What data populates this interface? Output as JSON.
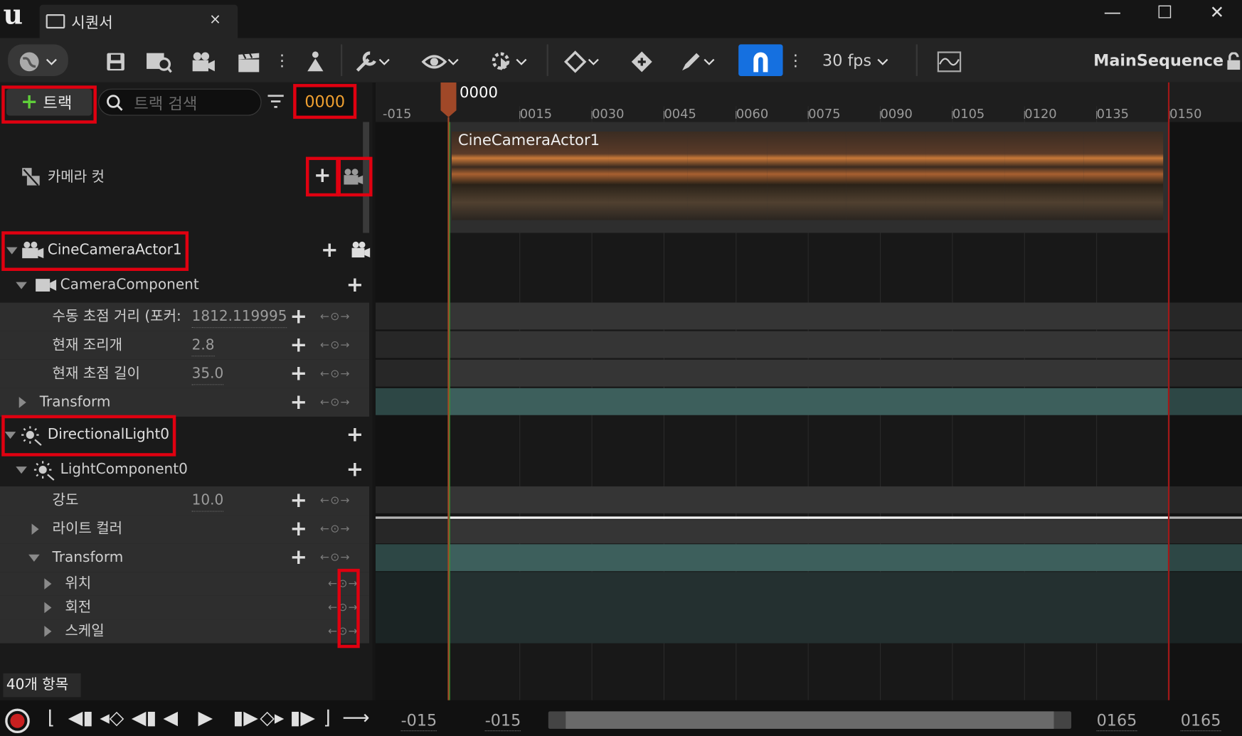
{
  "window": {
    "title": "시퀀서",
    "minimize": "—",
    "maximize": "☐",
    "close": "✕",
    "tab_close": "×",
    "logo": "u"
  },
  "toolbar": {
    "fps": "30 fps",
    "sequence_name": "MainSequence"
  },
  "track_panel": {
    "add_track_label": "트랙",
    "search_placeholder": "트랙 검색",
    "current_frame": "0000",
    "item_count": "40개 항목"
  },
  "tracks": {
    "camera_cuts": "카메라 컷",
    "cine_camera": "CineCameraActor1",
    "camera_component": "CameraComponent",
    "focus_distance": {
      "label": "수동 초점 거리 (포커:",
      "value": "1812.119995"
    },
    "aperture": {
      "label": "현재 조리개",
      "value": "2.8"
    },
    "focal_length": {
      "label": "현재 초점 길이",
      "value": "35.0"
    },
    "transform1": "Transform",
    "directional_light": "DirectionalLight0",
    "light_component": "LightComponent0",
    "intensity": {
      "label": "강도",
      "value": "10.0"
    },
    "light_color": "라이트 컬러",
    "transform2": "Transform",
    "location": "위치",
    "rotation": "회전",
    "scale": "스케일"
  },
  "timeline": {
    "playhead": "0000",
    "ruler_ticks": [
      "-015",
      "0015",
      "0030",
      "0045",
      "0060",
      "0075",
      "0090",
      "0105",
      "0120",
      "0135",
      "0150"
    ],
    "clip_label": "CineCameraActor1",
    "range_start_view": "-015",
    "range_start_work": "-015",
    "range_end_work": "0165",
    "range_end_view": "0165"
  },
  "colors": {
    "accent_blue": "#1570e0",
    "highlight_red": "#e00010",
    "frame_orange": "#f0a030",
    "track_teal": "#3d5f5c"
  }
}
